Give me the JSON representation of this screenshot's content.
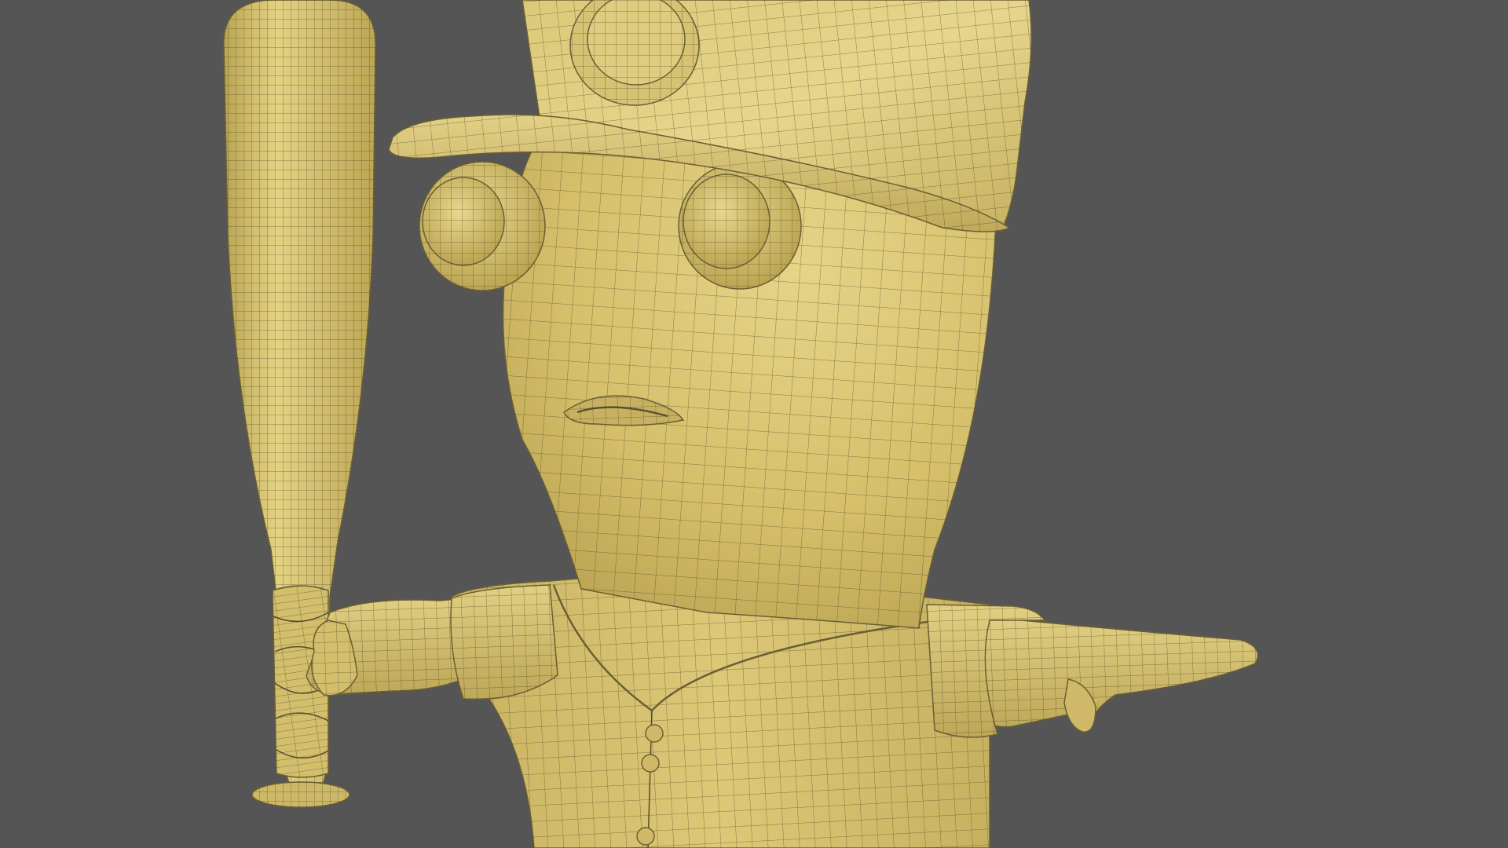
{
  "viewport": {
    "background_color": "#555555"
  },
  "model": {
    "description_icon": "baseball-player-character-icon",
    "base_color": "#d8c26e",
    "highlight_color": "#e8d68a",
    "shadow_color": "#a8944a",
    "wire_color": "#3e3a22",
    "display_mode": "wireframe-on-shaded"
  }
}
